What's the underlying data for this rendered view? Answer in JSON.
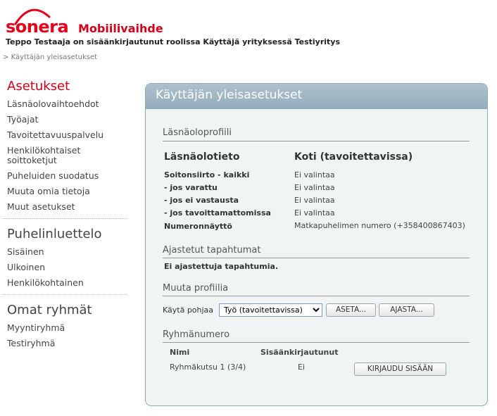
{
  "header": {
    "logo_text": "sonera",
    "app_title": "Mobiilivaihde",
    "user_line": "Teppo Testaaja on sisäänkirjautunut roolissa Käyttäjä yrityksessä Testiyritys",
    "breadcrumb": {
      "separator": ">",
      "current": "Käyttäjän yleisasetukset"
    }
  },
  "sidebar": {
    "asetukset": {
      "heading": "Asetukset",
      "items": [
        "Läsnäolovaihtoehdot",
        "Työajat",
        "Tavoitettavuuspalvelu",
        "Henkilökohtaiset soittoketjut",
        "Puheluiden suodatus",
        "Muuta omia tietoja",
        "Muut asetukset"
      ]
    },
    "puhelinluettelo": {
      "heading": "Puhelinluettelo",
      "items": [
        "Sisäinen",
        "Ulkoinen",
        "Henkilökohtainen"
      ]
    },
    "omat_ryhmat": {
      "heading": "Omat ryhmät",
      "items": [
        "Myyntiryhmä",
        "Testiryhmä"
      ]
    }
  },
  "main": {
    "title": "Käyttäjän yleisasetukset",
    "presence": {
      "section_title": "Läsnäoloprofiili",
      "col_left": "Läsnäolotieto",
      "col_right": "Koti (tavoitettavissa)",
      "rows": [
        {
          "label": "Soitonsiirto - kaikki",
          "value": "Ei valintaa"
        },
        {
          "label": "- jos varattu",
          "value": "Ei valintaa"
        },
        {
          "label": "- jos ei vastausta",
          "value": "Ei valintaa"
        },
        {
          "label": "- jos tavoittamattomissa",
          "value": "Ei valintaa"
        },
        {
          "label": "Numeronnäyttö",
          "value": "Matkapuhelimen numero (+358400867403)"
        }
      ]
    },
    "scheduled": {
      "section_title": "Ajastetut tapahtumat",
      "empty_text": "Ei ajastettuja tapahtumia."
    },
    "change_profile": {
      "section_title": "Muuta profiilia",
      "template_label": "Käytä pohjaa",
      "template_selected": "Työ (tavoitettavissa)",
      "set_button": "ASETA...",
      "schedule_button": "AJASTA..."
    },
    "group_number": {
      "section_title": "Ryhmänumero",
      "col_name": "Nimi",
      "col_logged_in": "Sisäänkirjautunut",
      "rows": [
        {
          "name": "Ryhmäkutsu 1 (3/4)",
          "logged_in": "Ei",
          "action": "KIRJAUDU SISÄÄN"
        }
      ]
    }
  },
  "colors": {
    "brand_red": "#e2001a",
    "panel_header": "#9db3c1",
    "panel_bg": "#f1f4f5",
    "panel_border": "#8fa9b8"
  }
}
